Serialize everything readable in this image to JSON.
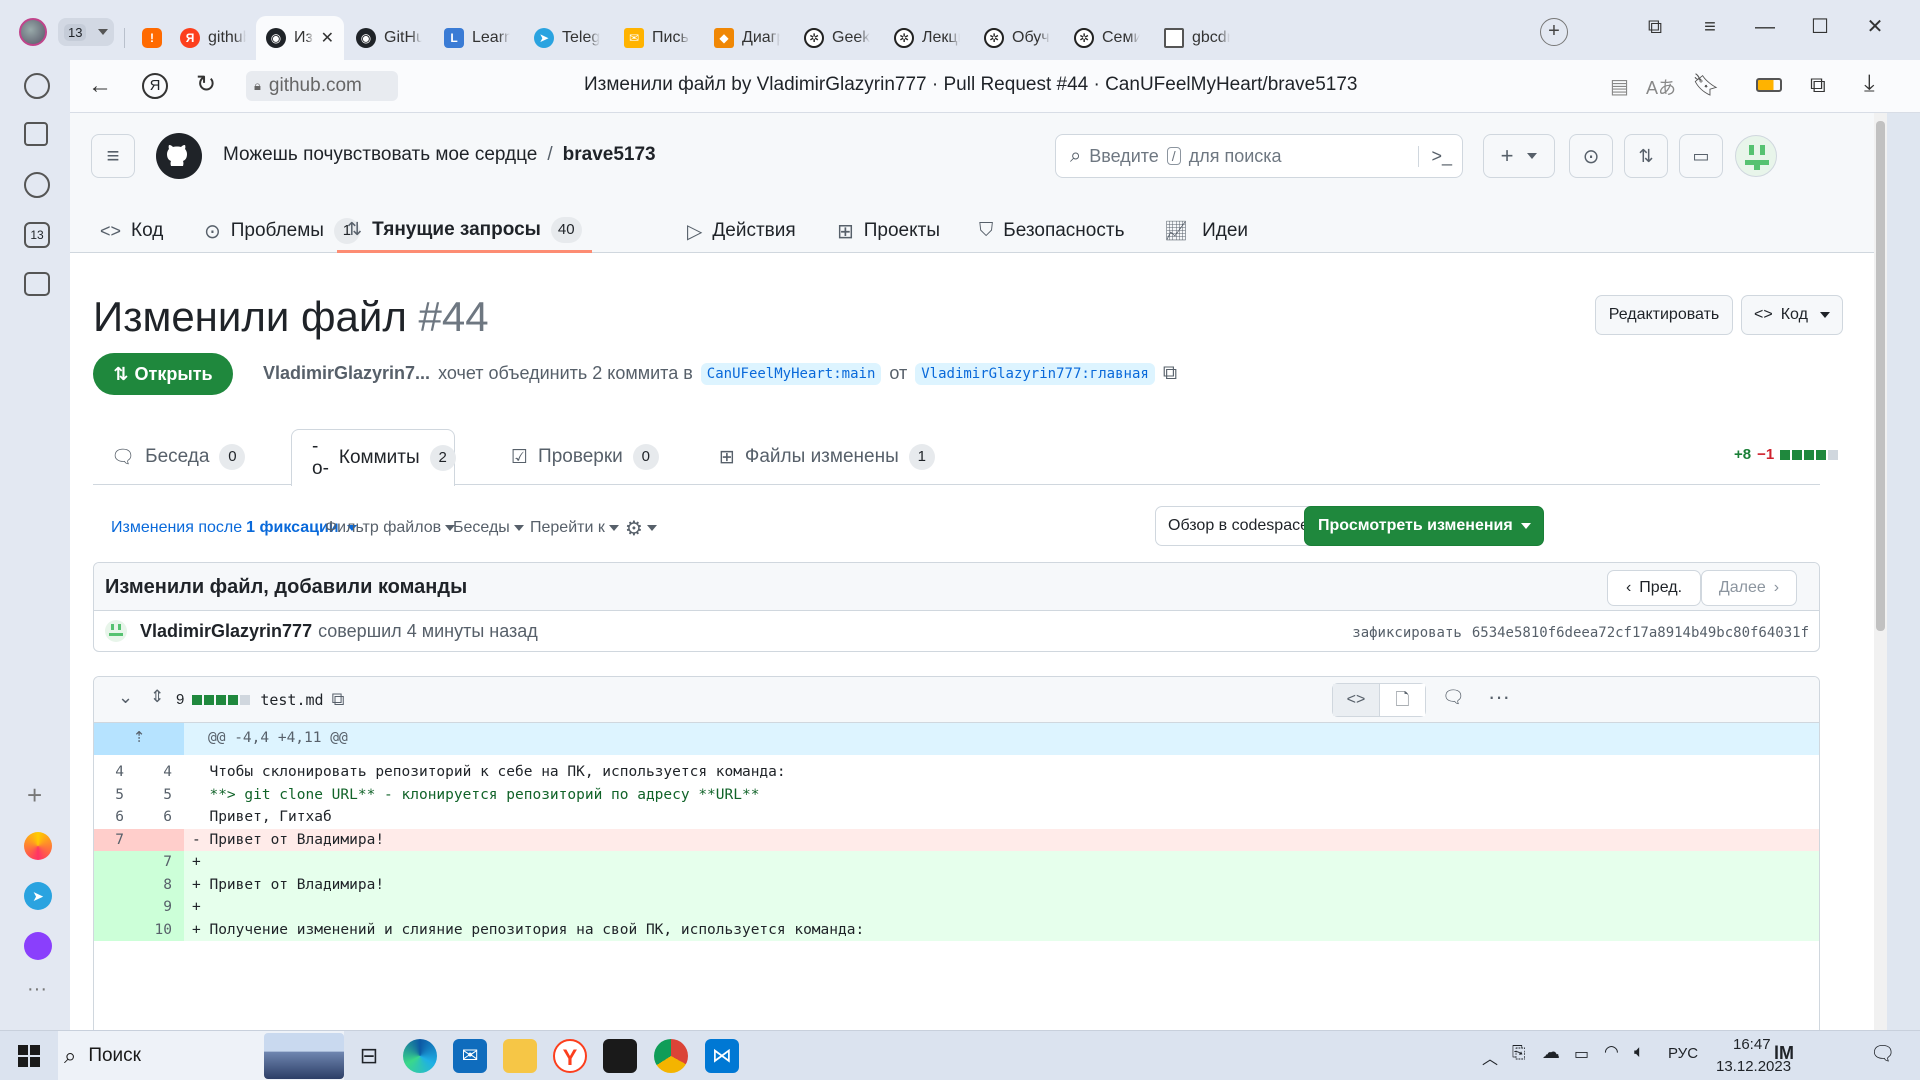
{
  "browser": {
    "tab_count": "13",
    "tabs": [
      {
        "label": "",
        "icon": "shield-icon",
        "color": "#ff6a00"
      },
      {
        "label": "github -",
        "icon": "yandex-icon",
        "color": "#fc3f1d"
      },
      {
        "label": "Изме",
        "icon": "github-icon",
        "color": "#1f2328",
        "active": true
      },
      {
        "label": "GitHub",
        "icon": "github-icon",
        "color": "#1f2328"
      },
      {
        "label": "Learn G",
        "icon": "learn-icon",
        "color": "#3a7bd5"
      },
      {
        "label": "Telegran",
        "icon": "telegram-icon",
        "color": "#2aa3e0"
      },
      {
        "label": "Письмо",
        "icon": "mail-icon",
        "color": "#ffb300"
      },
      {
        "label": "Диагра",
        "icon": "diagram-icon",
        "color": "#f08705"
      },
      {
        "label": "GeekBra",
        "icon": "openai-icon",
        "color": "#222"
      },
      {
        "label": "Лекция",
        "icon": "openai-icon",
        "color": "#222"
      },
      {
        "label": "Обучен",
        "icon": "openai-icon",
        "color": "#222"
      },
      {
        "label": "Семина",
        "icon": "openai-icon",
        "color": "#222"
      },
      {
        "label": "gbcdn.n",
        "icon": "file-icon",
        "color": "#555"
      }
    ],
    "address": "github.com",
    "page_title": "Изменили файл by VladimirGlazyrin777 · Pull Request #44 · CanUFeelMyHeart/brave5173"
  },
  "github": {
    "owner": "Можешь почувствовать мое сердце",
    "separator": "/",
    "repo": "brave5173",
    "search_placeholder_pre": "Введите",
    "search_key": "/",
    "search_placeholder_post": "для поиска",
    "nav": [
      {
        "label": "Код",
        "count": ""
      },
      {
        "label": "Проблемы",
        "count": "1"
      },
      {
        "label": "Тянущие запросы",
        "count": "40"
      },
      {
        "label": "Действия",
        "count": ""
      },
      {
        "label": "Проекты",
        "count": ""
      },
      {
        "label": "Безопасность",
        "count": ""
      },
      {
        "label": "Идеи",
        "count": ""
      }
    ]
  },
  "pr": {
    "title": "Изменили файл",
    "number": "#44",
    "edit_label": "Редактировать",
    "code_label": "Код",
    "state": "Открыть",
    "author": "VladimirGlazyrin7...",
    "merge_text": "хочет объединить 2 коммита в",
    "base_branch": "CanUFeelMyHeart:main",
    "from_text": "от",
    "head_branch": "VladimirGlazyrin777:главная",
    "tabs": [
      {
        "label": "Беседа",
        "count": "0"
      },
      {
        "label": "Коммиты",
        "count": "2"
      },
      {
        "label": "Проверки",
        "count": "0"
      },
      {
        "label": "Файлы изменены",
        "count": "1"
      }
    ],
    "additions": "+8",
    "deletions": "−1"
  },
  "toolbar": {
    "changes_since": "Изменения после",
    "changes_count": "1 фиксации",
    "filter_files": "Фильтр файлов",
    "conversations": "Беседы",
    "jump_to": "Перейти к",
    "codespace": "Обзор в codespace",
    "review": "Просмотреть изменения"
  },
  "commit": {
    "message": "Изменили файл, добавили команды",
    "prev": "Пред.",
    "next": "Далее",
    "author": "VladimirGlazyrin777",
    "action": "совершил 4 минуты назад",
    "sha_label": "зафиксировать",
    "sha": "6534e5810f6deea72cf17a8914b49bc80f64031f"
  },
  "file": {
    "changes": "9",
    "name": "test.md",
    "hunk": "@@ -4,4 +4,11 @@",
    "lines": [
      {
        "old": "4",
        "new": "4",
        "type": "ctx",
        "text": "  Чтобы склонировать репозиторий к себе на ПК, используется команда:"
      },
      {
        "old": "5",
        "new": "5",
        "type": "ctx",
        "text": "  **> git clone URL** - клонируется репозиторий по адресу **URL**"
      },
      {
        "old": "6",
        "new": "6",
        "type": "ctx",
        "text": "  Привет, Гитхаб"
      },
      {
        "old": "7",
        "new": "",
        "type": "del",
        "text": "- Привет от Владимира!"
      },
      {
        "old": "",
        "new": "7",
        "type": "add",
        "text": "+"
      },
      {
        "old": "",
        "new": "8",
        "type": "add",
        "text": "+ Привет от Владимира!"
      },
      {
        "old": "",
        "new": "9",
        "type": "add",
        "text": "+"
      },
      {
        "old": "",
        "new": "10",
        "type": "add",
        "text": "+ Получение изменений и слияние репозитория на свой ПК, используется команда:"
      }
    ]
  },
  "taskbar": {
    "search": "Поиск",
    "lang": "РУС",
    "time": "16:47",
    "date": "13.12.2023"
  },
  "colors": {
    "green": "#1f883d",
    "blue": "#0969da",
    "del_bg": "#ffebe9",
    "del_num": "#ffcecb",
    "add_bg": "#e6ffec",
    "add_num": "#ccffd8",
    "hunk_bg": "#ddf4ff",
    "tab_underline": "#fd8c73"
  }
}
